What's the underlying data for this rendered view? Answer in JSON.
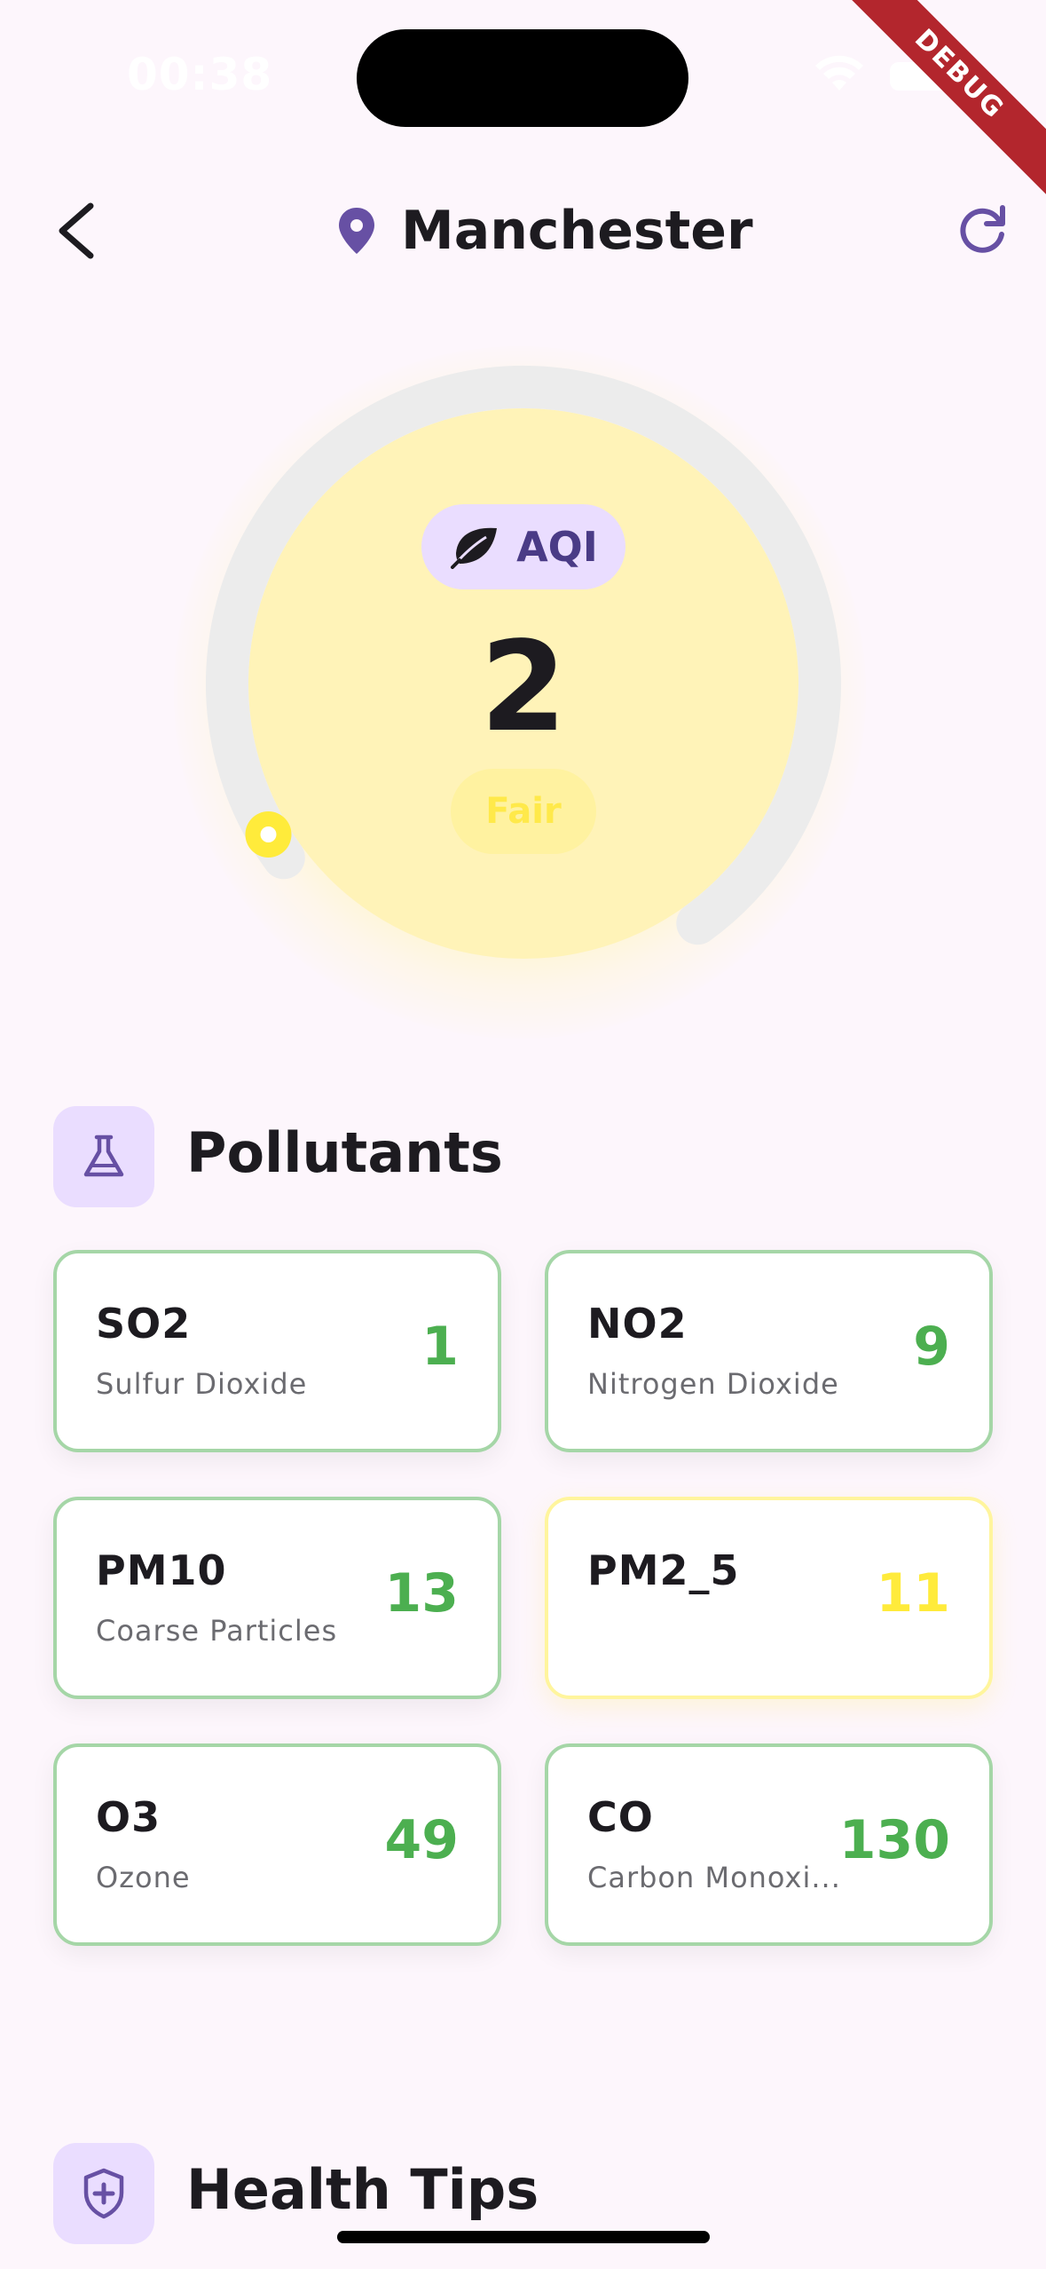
{
  "status_bar": {
    "time": "00:38"
  },
  "debug_banner": "DEBUG",
  "header": {
    "title": "Manchester"
  },
  "gauge": {
    "chip_label": "AQI",
    "value": "2",
    "status": "Fair",
    "level_fraction": 0.02,
    "accent_color": "#ffeb3b"
  },
  "pollutants": {
    "title": "Pollutants",
    "items": [
      {
        "code": "SO2",
        "name": "Sulfur Dioxide",
        "value": "1",
        "color": "#4caf50"
      },
      {
        "code": "NO2",
        "name": "Nitrogen Dioxide",
        "value": "9",
        "color": "#4caf50"
      },
      {
        "code": "PM10",
        "name": "Coarse Particles",
        "value": "13",
        "color": "#4caf50"
      },
      {
        "code": "PM2_5",
        "name": "",
        "value": "11",
        "color": "#ffeb3b"
      },
      {
        "code": "O3",
        "name": "Ozone",
        "value": "49",
        "color": "#4caf50"
      },
      {
        "code": "CO",
        "name": "Carbon Monoxi...",
        "value": "130",
        "color": "#4caf50"
      }
    ]
  },
  "health_tips": {
    "title": "Health Tips"
  },
  "colors": {
    "primary": "#6750a4",
    "chip_bg": "#eaddff",
    "good": "#4caf50",
    "fair": "#ffeb3b"
  },
  "icons": [
    "back-arrow-icon",
    "location-pin-icon",
    "refresh-icon",
    "leaf-icon",
    "flask-icon",
    "shield-plus-icon"
  ]
}
